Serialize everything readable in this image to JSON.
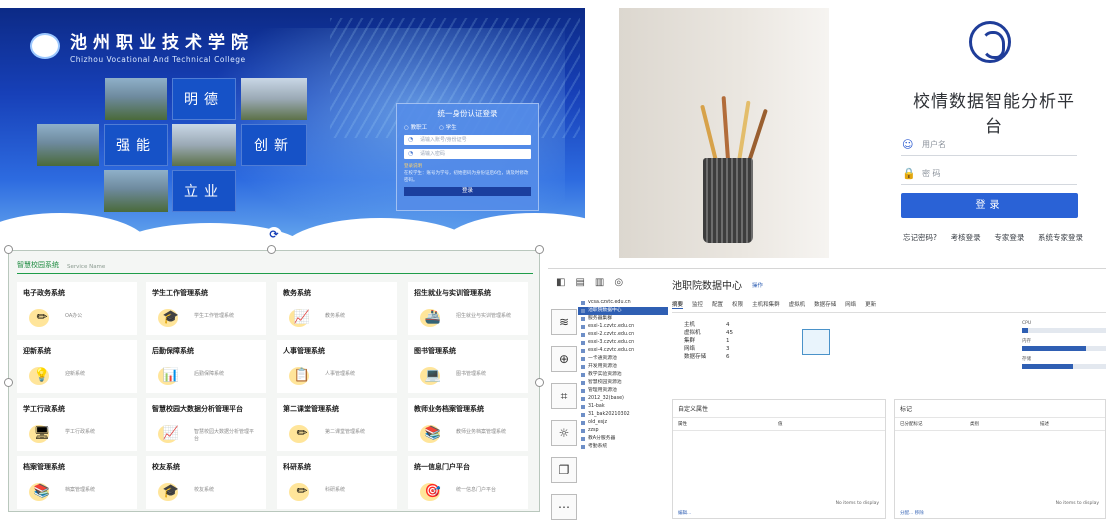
{
  "campus_login": {
    "school_cn": "池州职业技术学院",
    "school_en": "Chizhou Vocational And Technical College",
    "tiles": [
      "明德",
      "强能",
      "创新",
      "立业"
    ],
    "login_title": "统一身份认证登录",
    "roles": [
      "教职工",
      "学生"
    ],
    "username_placeholder": "请输入账号/身份证号",
    "password_placeholder": "请输入密码",
    "note_title": "登录说明",
    "note_text": "在校学生：账号为学号，初始密码为身份证后6位，请及时修改密码。",
    "login_button": "登录"
  },
  "analytics_login": {
    "title": "校情数据智能分析平台",
    "username_placeholder": "用户名",
    "password_placeholder": "密 码",
    "login_button": "登录",
    "links": [
      "忘记密码?",
      "考核登录",
      "专家登录",
      "系统专家登录"
    ]
  },
  "service_portal": {
    "header": "智慧校园系统",
    "header_sub": "Service Name",
    "cards": [
      {
        "name": "电子政务系统",
        "desc": "OA办公",
        "icon": "✏"
      },
      {
        "name": "学生工作管理系统",
        "desc": "学生工作管理系统",
        "icon": "🎓"
      },
      {
        "name": "教务系统",
        "desc": "教务系统",
        "icon": "📈"
      },
      {
        "name": "招生就业与实训管理系统",
        "desc": "招生就业与实训管理系统",
        "icon": "🚢"
      },
      {
        "name": "迎新系统",
        "desc": "迎新系统",
        "icon": "💡"
      },
      {
        "name": "后勤保障系统",
        "desc": "后勤保障系统",
        "icon": "📊"
      },
      {
        "name": "人事管理系统",
        "desc": "人事管理系统",
        "icon": "📋"
      },
      {
        "name": "图书管理系统",
        "desc": "图书管理系统",
        "icon": "💻"
      },
      {
        "name": "学工行政系统",
        "desc": "学工行政系统",
        "icon": "🖥"
      },
      {
        "name": "智慧校园大数据分析管理平台",
        "desc": "智慧校园大数据分析管理平台",
        "icon": "📈"
      },
      {
        "name": "第二课堂管理系统",
        "desc": "第二课堂管理系统",
        "icon": "✏"
      },
      {
        "name": "教师业务档案管理系统",
        "desc": "教师业务档案管理系统",
        "icon": "📚"
      },
      {
        "name": "档案管理系统",
        "desc": "档案管理系统",
        "icon": "📚"
      },
      {
        "name": "校友系统",
        "desc": "校友系统",
        "icon": "🎓"
      },
      {
        "name": "科研系统",
        "desc": "科研系统",
        "icon": "✏"
      },
      {
        "name": "统一信息门户平台",
        "desc": "统一信息门户平台",
        "icon": "🎯"
      }
    ]
  },
  "datacenter": {
    "title": "池职院数据中心",
    "actions_label": "操作",
    "tabs": [
      "摘要",
      "监控",
      "配置",
      "权限",
      "主机和集群",
      "虚拟机",
      "数据存储",
      "网络",
      "更新"
    ],
    "stats": [
      {
        "k": "主机",
        "v": "4"
      },
      {
        "k": "虚拟机",
        "v": "45"
      },
      {
        "k": "集群",
        "v": "1"
      },
      {
        "k": "网络",
        "v": "3"
      },
      {
        "k": "数据存储",
        "v": "6"
      }
    ],
    "tree": [
      "vcsa.czvtc.edu.cn",
      "池职院数据中心",
      "服务器集群",
      "esxi-1.czvtc.edu.cn",
      "esxi-2.czvtc.edu.cn",
      "esxi-3.czvtc.edu.cn",
      "esxi-4.czvtc.edu.cn",
      "一卡通资源池",
      "开发用资源池",
      "教学实验资源池",
      "智慧校园资源池",
      "管理用资源池",
      "2012_32(base)",
      "31-bak",
      "31_bak20210302",
      "old_esjz",
      "zzsp",
      "教A分服务器",
      "考勤系统"
    ],
    "resources": [
      {
        "label": "CPU",
        "pct": 0.06
      },
      {
        "label": "内存",
        "pct": 0.62
      },
      {
        "label": "存储",
        "pct": 0.49
      }
    ],
    "custom_attrs_title": "自定义属性",
    "custom_attrs_cols": [
      "属性",
      "值"
    ],
    "tags_title": "标记",
    "tags_cols": [
      "已分配标记",
      "类别",
      "描述"
    ],
    "empty_text": "No items to display",
    "edit_link": "编辑...",
    "assign_link": "分配... 移除"
  }
}
